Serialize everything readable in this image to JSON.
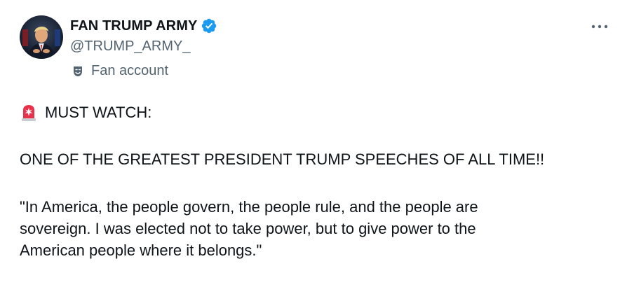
{
  "author": {
    "display_name": "FAN TRUMP ARMY",
    "handle": "@TRUMP_ARMY_",
    "label": "Fan account",
    "verified_icon": "verified-badge-icon",
    "label_icon": "theater-masks-icon"
  },
  "post": {
    "headline": "MUST WATCH:",
    "line2": "ONE OF THE GREATEST PRESIDENT TRUMP SPEECHES OF ALL TIME!!",
    "quote_lines": [
      "\"In America, the people govern, the people rule, and the people are",
      "sovereign. I was elected not to take power, but to give power to the",
      "American people where it belongs.\""
    ],
    "headline_icon": "police-siren-emoji"
  },
  "menu": {
    "icon": "more-options-icon"
  },
  "colors": {
    "text": "#0f1419",
    "secondary": "#536471",
    "verified_blue": "#1d9bf0",
    "siren_red": "#e8324b"
  }
}
